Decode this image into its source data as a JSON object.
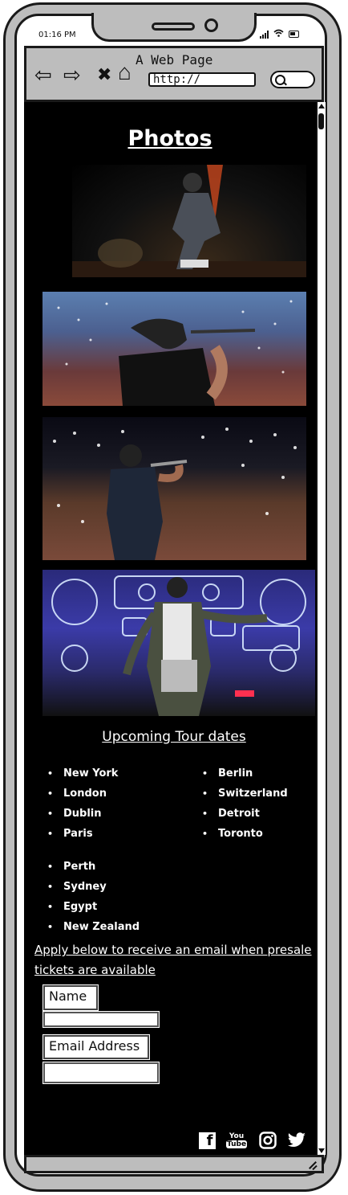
{
  "status_bar": {
    "time": "01:16 PM"
  },
  "browser": {
    "page_title": "A Web Page",
    "url": "http://",
    "nav": {
      "back": "⇦",
      "forward": "⇨",
      "stop": "✖",
      "home": "⌂"
    }
  },
  "page": {
    "photos_heading": "Photos",
    "photos": [
      {
        "name": "photo-1"
      },
      {
        "name": "photo-2"
      },
      {
        "name": "photo-3"
      },
      {
        "name": "photo-4"
      }
    ],
    "tour_heading": "Upcoming Tour dates",
    "tour_col1": [
      "New York",
      "London",
      "Dublin",
      "Paris"
    ],
    "tour_col2": [
      "Berlin",
      "Switzerland",
      "Detroit",
      "Toronto"
    ],
    "tour_col3": [
      "Perth",
      "Sydney",
      "Egypt",
      "New Zealand"
    ],
    "presale_text": "Apply below to receive an email when presale tickets are available",
    "form": {
      "name_label": "Name",
      "email_label": "Email Address",
      "name_value": "",
      "email_value": ""
    },
    "social": {
      "facebook": "f",
      "youtube_top": "You",
      "youtube_bottom": "Tube"
    }
  }
}
